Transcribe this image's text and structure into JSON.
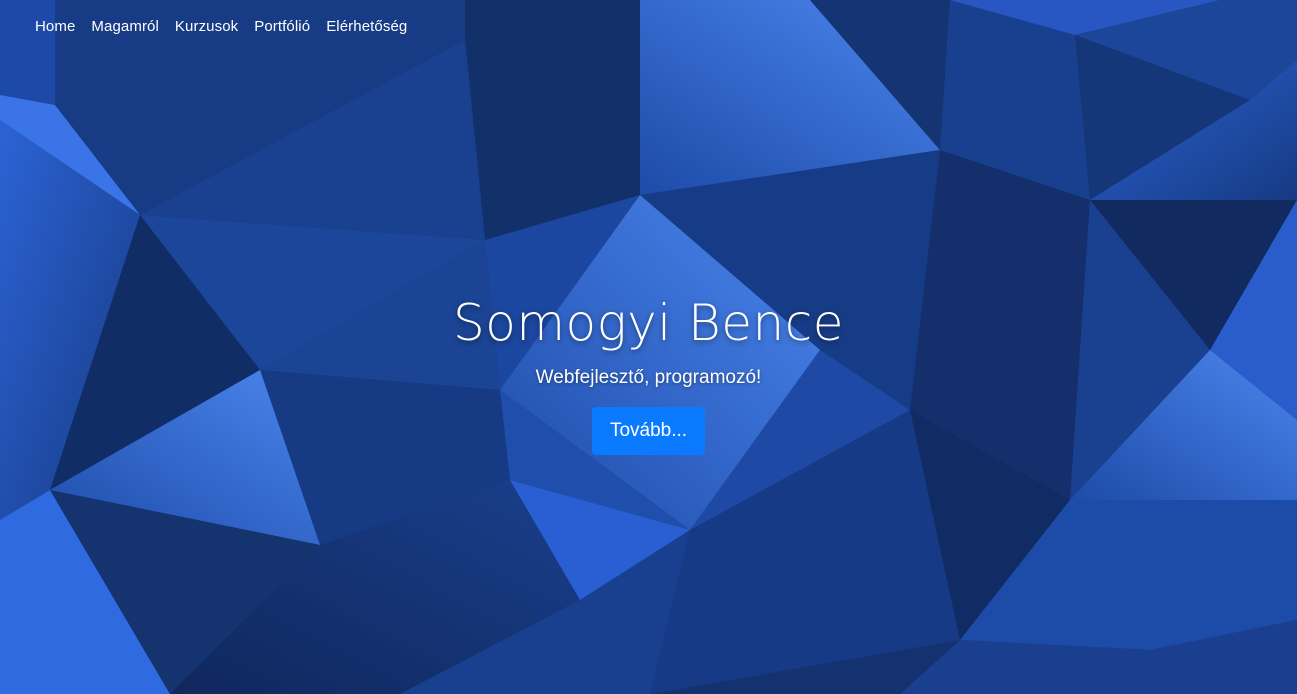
{
  "nav": {
    "items": [
      {
        "label": "Home"
      },
      {
        "label": "Magamról"
      },
      {
        "label": "Kurzusok"
      },
      {
        "label": "Portfólió"
      },
      {
        "label": "Elérhetőség"
      }
    ]
  },
  "hero": {
    "title": "Somogyi Bence",
    "subtitle": "Webfejlesztő, programozó!",
    "button_label": "Tovább..."
  },
  "colors": {
    "background_dark": "#0f2a62",
    "background_mid": "#1a4192",
    "background_light": "#2f6ae0",
    "button": "#0a7bff",
    "text": "#ffffff"
  }
}
